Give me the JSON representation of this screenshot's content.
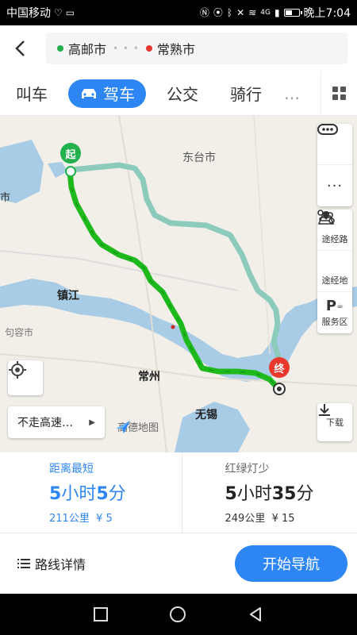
{
  "status_bar": {
    "carrier": "中国移动",
    "network": "4G",
    "time": "晚上7:04",
    "battery_level": 0.55
  },
  "header": {
    "origin": "高邮市",
    "destination": "常熟市"
  },
  "tabs": [
    {
      "label": "叫车"
    },
    {
      "label": "驾车"
    },
    {
      "label": "公交"
    },
    {
      "label": "骑行"
    },
    {
      "label": "…"
    }
  ],
  "map": {
    "labels": {
      "dongtai": "东台市",
      "city_left": "市",
      "zhenjiang": "镇江",
      "jurong": "句容市",
      "changzhou": "常州",
      "wuxi": "无锡"
    },
    "start_pin": "起",
    "end_pin": "终",
    "tools": {
      "waypoint_road": "途经路",
      "waypoint_place": "途经地",
      "service_area": "服务区",
      "download": "下载"
    },
    "avoid_label": "不走高速…",
    "logo_text": "高德地图"
  },
  "options": [
    {
      "tag": "距离最短",
      "time_h": "5",
      "time_h_unit": "小时",
      "time_m": "5",
      "time_m_unit": "分",
      "distance": "211公里",
      "cost": "¥ 5"
    },
    {
      "tag": "红绿灯少",
      "time_h": "5",
      "time_h_unit": "小时",
      "time_m": "35",
      "time_m_unit": "分",
      "distance": "249公里",
      "cost": "¥ 15"
    }
  ],
  "bottom": {
    "detail_label": "路线详情",
    "nav_label": "开始导航"
  },
  "colors": {
    "accent": "#2e86f5",
    "route_main": "#1db91d",
    "route_alt": "#8ccbbc",
    "water": "#a8cbe6",
    "start": "#22b14c",
    "end": "#e8392c"
  }
}
